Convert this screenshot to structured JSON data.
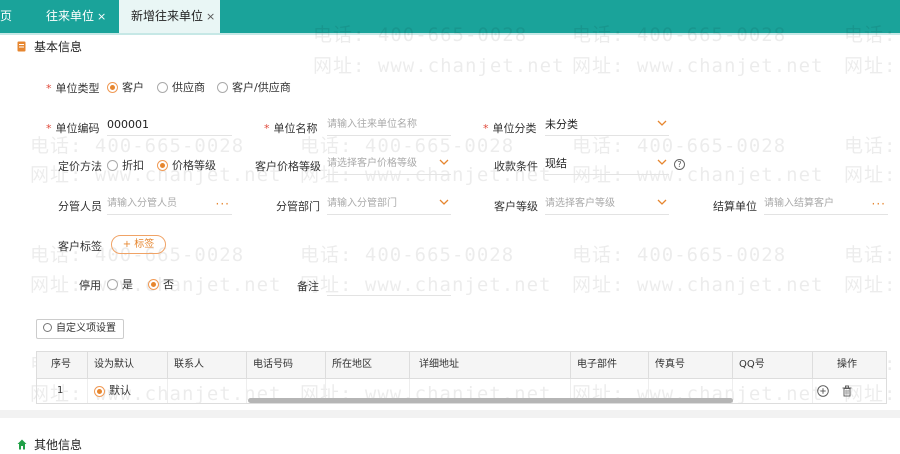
{
  "tabs": {
    "home": "页",
    "units": "往来单位",
    "new_unit": "新增往来单位",
    "close": "×"
  },
  "watermark": {
    "phone": "电话: 400-665-0028",
    "site": "网址: www.chanjet.net"
  },
  "sections": {
    "basic": "基本信息",
    "other": "其他信息"
  },
  "form": {
    "unit_type": {
      "label": "单位类型",
      "options": [
        "客户",
        "供应商",
        "客户/供应商"
      ],
      "selected": "客户"
    },
    "unit_code": {
      "label": "单位编码",
      "value": "000001"
    },
    "unit_name": {
      "label": "单位名称",
      "placeholder": "请输入往来单位名称"
    },
    "unit_category": {
      "label": "单位分类",
      "value": "未分类"
    },
    "pricing": {
      "label": "定价方法",
      "options": [
        "折扣",
        "价格等级"
      ],
      "selected": "价格等级"
    },
    "price_level": {
      "label": "客户价格等级",
      "placeholder": "请选择客户价格等级"
    },
    "payment_terms": {
      "label": "收款条件",
      "value": "现结"
    },
    "salesperson": {
      "label": "分管人员",
      "placeholder": "请输入分管人员"
    },
    "department": {
      "label": "分管部门",
      "placeholder": "请输入分管部门"
    },
    "customer_level": {
      "label": "客户等级",
      "placeholder": "请选择客户等级"
    },
    "settlement_unit": {
      "label": "结算单位",
      "placeholder": "请输入结算客户"
    },
    "customer_tag": {
      "label": "客户标签",
      "button": "+ 标签"
    },
    "disabled": {
      "label": "停用",
      "options": [
        "是",
        "否"
      ],
      "selected": "否"
    },
    "remark": {
      "label": "备注"
    }
  },
  "custom_button": "自定义项设置",
  "table": {
    "columns": [
      "序号",
      "设为默认",
      "联系人",
      "电话号码",
      "所在地区",
      "详细地址",
      "电子部件",
      "传真号",
      "QQ号",
      "操作"
    ],
    "rows": [
      {
        "index": "1",
        "default_label": "默认"
      }
    ]
  },
  "colors": {
    "accent": "#1aa39a",
    "orange": "#e6862f",
    "required": "#e14a3b"
  }
}
